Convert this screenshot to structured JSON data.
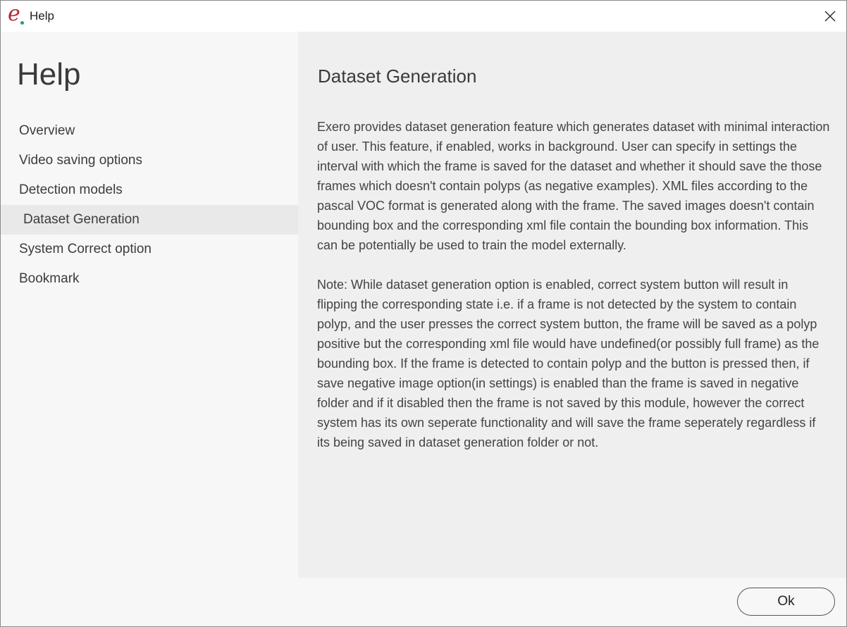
{
  "window": {
    "title": "Help",
    "logo_icon": "exero-logo-icon",
    "close_icon": "close-icon"
  },
  "sidebar": {
    "title": "Help",
    "items": [
      {
        "label": "Overview"
      },
      {
        "label": "Video saving options"
      },
      {
        "label": "Detection models"
      },
      {
        "label": "Dataset Generation",
        "active": true
      },
      {
        "label": "System Correct option"
      },
      {
        "label": "Bookmark"
      }
    ]
  },
  "content": {
    "title": "Dataset Generation",
    "paragraphs": [
      "Exero provides dataset generation feature which generates dataset with minimal interaction of user. This feature, if enabled, works in background. User can specify in settings the interval with which the frame is saved for the dataset and whether it should save the those frames which doesn't contain polyps (as negative examples). XML files according to the pascal VOC format is generated along with the frame. The saved images doesn't contain bounding box and the corresponding xml file contain the bounding box information. This can be potentially be used to train the model externally.",
      "Note: While dataset generation option is enabled, correct system button will result in flipping the corresponding state i.e. if a frame is not detected by the system to contain polyp, and the user presses the correct system button, the frame will be saved as a polyp positive but the corresponding xml file would have undefined(or possibly full frame) as the bounding box. If the frame is detected to contain polyp and the button is pressed then, if save negative image option(in settings) is enabled than the frame is saved in negative folder and if it disabled then the frame is not saved by this module, however the correct system has its own seperate functionality and will save the frame seperately regardless if its being saved in dataset generation folder or not."
    ]
  },
  "footer": {
    "ok_label": "Ok"
  },
  "colors": {
    "logo_e": "#b8263a",
    "logo_dot": "#2e9b6a",
    "content_bg": "#efefef",
    "sidebar_bg": "#f7f7f7",
    "active_item_bg": "#e9e9e9"
  }
}
